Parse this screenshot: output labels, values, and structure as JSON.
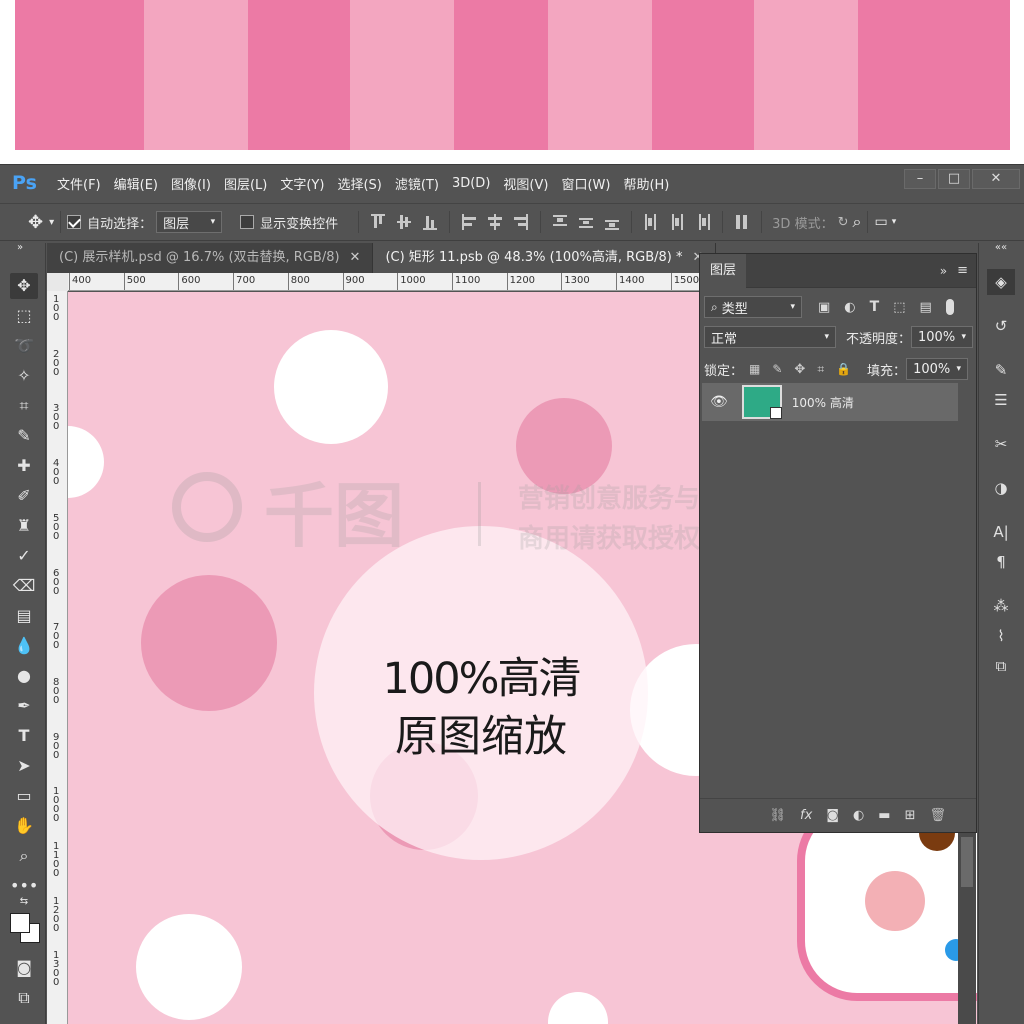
{
  "banner": {
    "colors": [
      "#ec7aa5",
      "#f3a6c0",
      "#ec7aa5",
      "#f3a6c0",
      "#ec7aa5",
      "#f3a6c0",
      "#ec7aa5",
      "#f3a6c0",
      "#ec7aa5"
    ]
  },
  "app": {
    "logo": "Ps",
    "menu": [
      "文件(F)",
      "编辑(E)",
      "图像(I)",
      "图层(L)",
      "文字(Y)",
      "选择(S)",
      "滤镜(T)",
      "3D(D)",
      "视图(V)",
      "窗口(W)",
      "帮助(H)"
    ],
    "window_controls": [
      "–",
      "□",
      "✕"
    ]
  },
  "options": {
    "move_icon": "✥",
    "auto_select_label": "自动选择：",
    "auto_select_target": "图层",
    "show_transform_label": "显示变换控件",
    "mode_3d_label": "3D 模式："
  },
  "tabs": [
    {
      "label": "(C) 展示样机.psd @ 16.7% (双击替换, RGB/8)",
      "close": "✕",
      "active": false
    },
    {
      "label": "(C) 矩形 11.psb @ 48.3% (100%高清, RGB/8) *",
      "close": "✕",
      "active": true
    }
  ],
  "ruler": {
    "h_ticks": [
      "400",
      "500",
      "600",
      "700",
      "800",
      "900",
      "1000",
      "1100",
      "1200",
      "1300",
      "1400",
      "1500"
    ],
    "v_ticks": [
      "100",
      "200",
      "300",
      "400",
      "500",
      "600",
      "700",
      "800",
      "900",
      "1000",
      "1100",
      "1200",
      "1300"
    ]
  },
  "canvas": {
    "bg_color": "#f7c5d5",
    "line1": "100%高清",
    "line2": "原图缩放",
    "watermark_brand": "千图",
    "watermark_line1": "营销创意服务与协作平台",
    "watermark_line2": "商用请获取授权"
  },
  "layers_panel": {
    "title": "图层",
    "filter_label": "类型",
    "blend_mode": "正常",
    "opacity_label": "不透明度：",
    "opacity_value": "100%",
    "lock_label": "锁定：",
    "fill_label": "填充：",
    "fill_value": "100%",
    "layer_name": "100% 高清",
    "layer_thumb_color": "#2eaa86",
    "bottom_icons": [
      "link-icon",
      "fx-icon",
      "mask-icon",
      "adjustment-icon",
      "folder-icon",
      "new-layer-icon",
      "trash-icon"
    ]
  }
}
